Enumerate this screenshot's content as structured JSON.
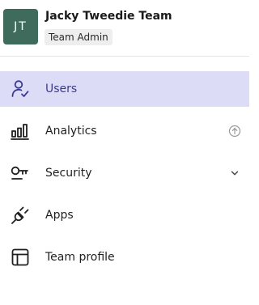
{
  "team": {
    "initials": "JT",
    "name": "Jacky Tweedie Team",
    "role": "Team Admin"
  },
  "nav": {
    "items": [
      {
        "label": "Users",
        "icon": "user-check-icon",
        "active": true
      },
      {
        "label": "Analytics",
        "icon": "bar-chart-icon",
        "trailing_icon": "upgrade-arrow-icon"
      },
      {
        "label": "Security",
        "icon": "key-icon",
        "trailing_icon": "chevron-down-icon"
      },
      {
        "label": "Apps",
        "icon": "plug-icon"
      },
      {
        "label": "Team profile",
        "icon": "layout-icon"
      }
    ]
  },
  "colors": {
    "avatar_bg": "#3e6b5b",
    "active_bg": "#dcdcf7",
    "active_text": "#3b3a91"
  }
}
